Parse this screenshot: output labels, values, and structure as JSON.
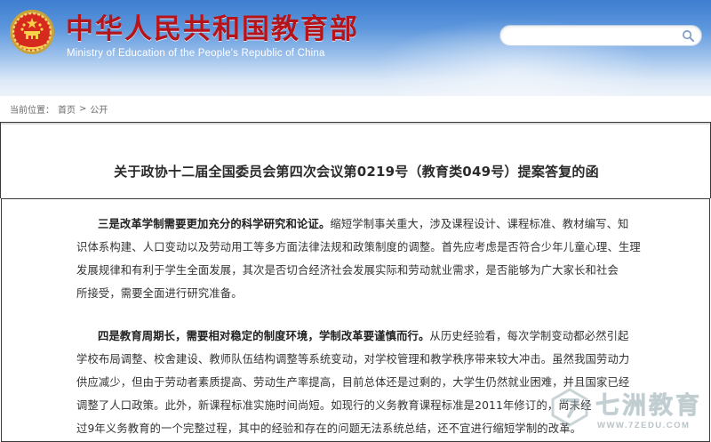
{
  "header": {
    "title_cn": "中华人民共和国教育部",
    "title_en": "Ministry of Education of the People's Republic of China",
    "search_value": "",
    "search_icon": "search-icon",
    "emblem_icon": "national-emblem-icon"
  },
  "breadcrumb": {
    "label": "当前位置：",
    "items": [
      "首页",
      "公开"
    ],
    "separator": ">"
  },
  "article": {
    "title": "关于政协十二届全国委员会第四次会议第0219号（教育类049号）提案答复的函",
    "para1": {
      "lead": "三是改革学制需要更加充分的科学研究和论证。",
      "lines": [
        "缩短学制事关重大，涉及课程设计、课程标准、教材编写、知",
        "识体系构建、人口变动以及劳动用工等多方面法律法规和政策制度的调整。首先应考虑是否符合少年儿童心理、生理",
        "发展规律和有利于学生全面发展，其次是否切合经济社会发展实际和劳动就业需求，是否能够为广大家长和社会",
        "所接受，需要全面进行研究准备。"
      ]
    },
    "para2": {
      "lead": "四是教育周期长，需要相对稳定的制度环境，学制改革要谨慎而行。",
      "lines": [
        "从历史经验看，每次学制变动都必然引起",
        "学校布局调整、校舍建设、教师队伍结构调整等系统变动，对学校管理和教学秩序带来较大冲击。虽然我国劳动力",
        "供应减少，但由于劳动者素质提高、劳动生产率提高，目前总体还是过剩的，大学生仍然就业困难，并且国家已经",
        "调整了人口政策。此外，新课程标准实施时间尚短。如现行的义务教育课程标准是2011年修订的，尚未经",
        "过9年义务教育的一个完整过程，其中的经验和存在的问题无法系统总结，还不宜进行缩短学制的改革。"
      ]
    }
  },
  "watermark": {
    "text": "七洲教育",
    "url": "WWW.7ZEDU.COM",
    "icon": "7zedu-logo-icon"
  },
  "colors": {
    "header_blue": "#3e7ed0",
    "title_red": "#b5151a",
    "body_text": "#333333"
  }
}
